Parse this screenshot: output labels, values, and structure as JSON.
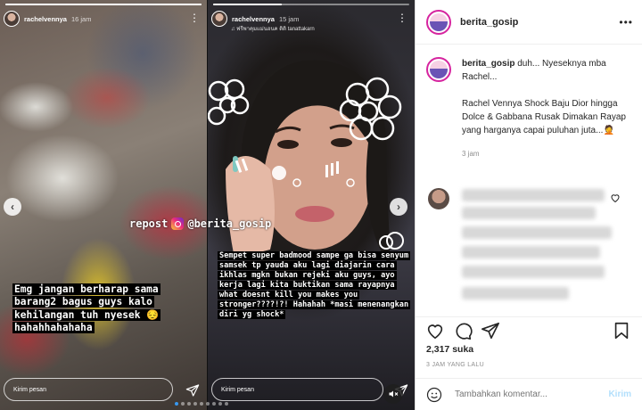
{
  "post_author": "berita_gosip",
  "story_left": {
    "username": "rachelvennya",
    "time": "16 jam",
    "caption": "Emg jangan berharap sama barang2 bagus guys kalo kehilangan tuh nyesek 😔 hahahhahahaha",
    "reply_placeholder": "Kirim pesan",
    "progress": 1.0
  },
  "story_right": {
    "username": "rachelvennya",
    "time": "15 jam",
    "subtitle": "♫ ฟรีพาคุมแม่นอนค ดิดิ tanattakarn",
    "caption": "Sempet super badmood sampe ga bisa senyum samsek tp yauda aku lagi diajarin cara ikhlas mgkn bukan rejeki aku guys, ayo kerja lagi kita buktikan sama rayapnya what doesnt kill you makes you stronger????!?! Hahahah *masi menenangkan diri yg shock*",
    "reply_placeholder": "Kirim pesan",
    "progress": 0.35
  },
  "repost": {
    "prefix": "repost",
    "handle": "@berita_gosip"
  },
  "carousel": {
    "total": 9,
    "active": 0
  },
  "panel": {
    "header_username": "berita_gosip",
    "caption_username": "berita_gosip",
    "caption_intro": "duh... Nyeseknya mba Rachel...",
    "caption_body": "Rachel Vennya Shock Baju Dior hingga Dolce & Gabbana Rusak Dimakan Rayap yang harganya capai puluhan juta...🤦",
    "caption_time": "3 jam",
    "likes": "2,317 suka",
    "post_date": "3 JAM YANG LALU",
    "comment_placeholder": "Tambahkan komentar...",
    "post_button": "Kirim"
  },
  "colors": {
    "link_blue": "#3897f0",
    "post_button_disabled": "#b2dffc",
    "ring_gradient": "#d6249f"
  },
  "icons": [
    "more-icon",
    "heart-icon",
    "comment-icon",
    "share-icon",
    "bookmark-icon",
    "emoji-icon",
    "send-icon",
    "mute-icon",
    "chevron-left-icon",
    "chevron-right-icon",
    "instagram-icon"
  ]
}
